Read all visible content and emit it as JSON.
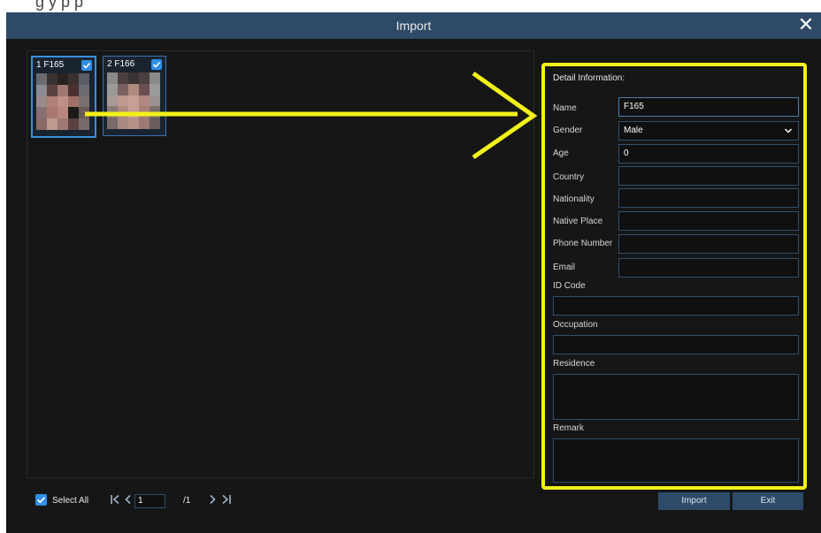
{
  "window": {
    "title": "Import"
  },
  "thumbnails": [
    {
      "label": "1 F165",
      "checked": true
    },
    {
      "label": "2 F166",
      "checked": true
    }
  ],
  "detail": {
    "title": "Detail Information:",
    "fields": {
      "name": {
        "label": "Name",
        "value": "F165"
      },
      "gender": {
        "label": "Gender",
        "value": "Male"
      },
      "age": {
        "label": "Age",
        "value": "0"
      },
      "country": {
        "label": "Country",
        "value": ""
      },
      "nationality": {
        "label": "Nationality",
        "value": ""
      },
      "native_place": {
        "label": "Native Place",
        "value": ""
      },
      "phone": {
        "label": "Phone Number",
        "value": ""
      },
      "email": {
        "label": "Email",
        "value": ""
      },
      "id_code": {
        "label": "ID Code",
        "value": ""
      },
      "occupation": {
        "label": "Occupation",
        "value": ""
      },
      "residence": {
        "label": "Residence",
        "value": ""
      },
      "remark": {
        "label": "Remark",
        "value": ""
      }
    }
  },
  "footer": {
    "select_all_label": "Select All",
    "page_current": "1",
    "page_total": "/1",
    "import_label": "Import",
    "exit_label": "Exit"
  },
  "colors": {
    "background": "#161616",
    "titlebar": "#2d4a68",
    "accent": "#2f8fe6",
    "annotation": "#f2f11a"
  },
  "icons": [
    "close-icon",
    "checkbox-checked-icon",
    "chevron-down-icon",
    "first-page-icon",
    "prev-page-icon",
    "next-page-icon",
    "last-page-icon"
  ]
}
